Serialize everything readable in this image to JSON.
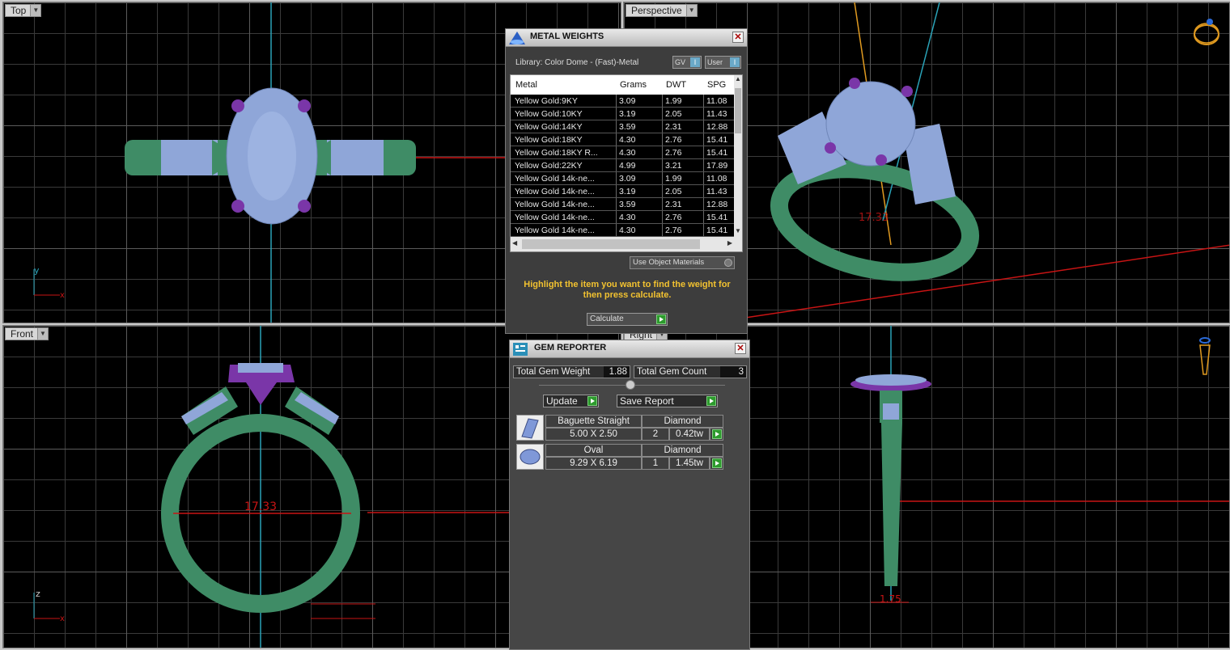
{
  "viewports": {
    "top": {
      "label": "Top",
      "axis_h": "x",
      "axis_v": "y"
    },
    "perspective": {
      "label": "Perspective"
    },
    "front": {
      "label": "Front",
      "axis_h": "x",
      "axis_v": "z",
      "dimension": "17.33"
    },
    "right": {
      "label": "Right",
      "dimension": "1.75"
    }
  },
  "metal_weights": {
    "title": "METAL WEIGHTS",
    "library": "Library: Color Dome - (Fast)-Metal",
    "toggle_gv": "GV",
    "toggle_user": "User",
    "columns": [
      "Metal",
      "Grams",
      "DWT",
      "SPG"
    ],
    "rows": [
      [
        "Yellow Gold:9KY",
        "3.09",
        "1.99",
        "11.08"
      ],
      [
        "Yellow Gold:10KY",
        "3.19",
        "2.05",
        "11.43"
      ],
      [
        "Yellow Gold:14KY",
        "3.59",
        "2.31",
        "12.88"
      ],
      [
        "Yellow Gold:18KY",
        "4.30",
        "2.76",
        "15.41"
      ],
      [
        "Yellow Gold:18KY R...",
        "4.30",
        "2.76",
        "15.41"
      ],
      [
        "Yellow Gold:22KY",
        "4.99",
        "3.21",
        "17.89"
      ],
      [
        "Yellow Gold 14k-ne...",
        "3.09",
        "1.99",
        "11.08"
      ],
      [
        "Yellow Gold 14k-ne...",
        "3.19",
        "2.05",
        "11.43"
      ],
      [
        "Yellow Gold 14k-ne...",
        "3.59",
        "2.31",
        "12.88"
      ],
      [
        "Yellow Gold 14k-ne...",
        "4.30",
        "2.76",
        "15.41"
      ],
      [
        "Yellow Gold 14k-ne...",
        "4.30",
        "2.76",
        "15.41"
      ]
    ],
    "use_object_materials": "Use Object Materials",
    "hint": "Highlight the item you want to find the weight for then press calculate.",
    "calculate": "Calculate"
  },
  "gem_reporter": {
    "title": "GEM REPORTER",
    "total_weight_label": "Total Gem Weight",
    "total_weight": "1.88",
    "total_count_label": "Total Gem Count",
    "total_count": "3",
    "update": "Update",
    "save_report": "Save Report",
    "gems": [
      {
        "shape": "Baguette Straight",
        "type": "Diamond",
        "size": "5.00 X 2.50",
        "count": "2",
        "weight": "0.42tw",
        "icon": "baguette-gem-icon"
      },
      {
        "shape": "Oval",
        "type": "Diamond",
        "size": "9.29 X 6.19",
        "count": "1",
        "weight": "1.45tw",
        "icon": "oval-gem-icon"
      }
    ]
  },
  "colors": {
    "band": "#3f8c66",
    "stone": "#8fa6d8",
    "prongs": "#7a36a8",
    "axis_red": "#c81414",
    "axis_blue": "#2aa3b8",
    "hint_yellow": "#f2c230"
  }
}
